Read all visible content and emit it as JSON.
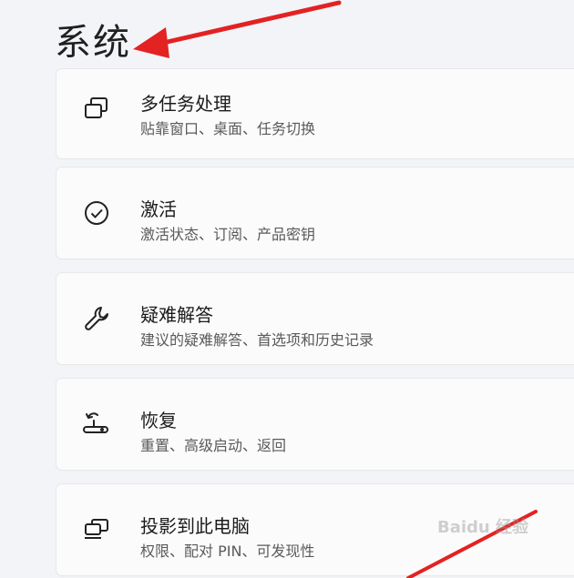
{
  "header": {
    "title": "系统"
  },
  "items": [
    {
      "label": "多任务处理",
      "desc": "贴靠窗口、桌面、任务切换",
      "icon": "multitasking-icon"
    },
    {
      "label": "激活",
      "desc": "激活状态、订阅、产品密钥",
      "icon": "check-circle-icon"
    },
    {
      "label": "疑难解答",
      "desc": "建议的疑难解答、首选项和历史记录",
      "icon": "wrench-icon"
    },
    {
      "label": "恢复",
      "desc": "重置、高级启动、返回",
      "icon": "recovery-icon"
    },
    {
      "label": "投影到此电脑",
      "desc": "权限、配对 PIN、可发现性",
      "icon": "project-to-pc-icon"
    }
  ],
  "watermark": {
    "text": "Baidu 经验"
  },
  "colors": {
    "arrow": "#e32222",
    "card": "#fbfbfc",
    "background": "#f2f4f7"
  }
}
